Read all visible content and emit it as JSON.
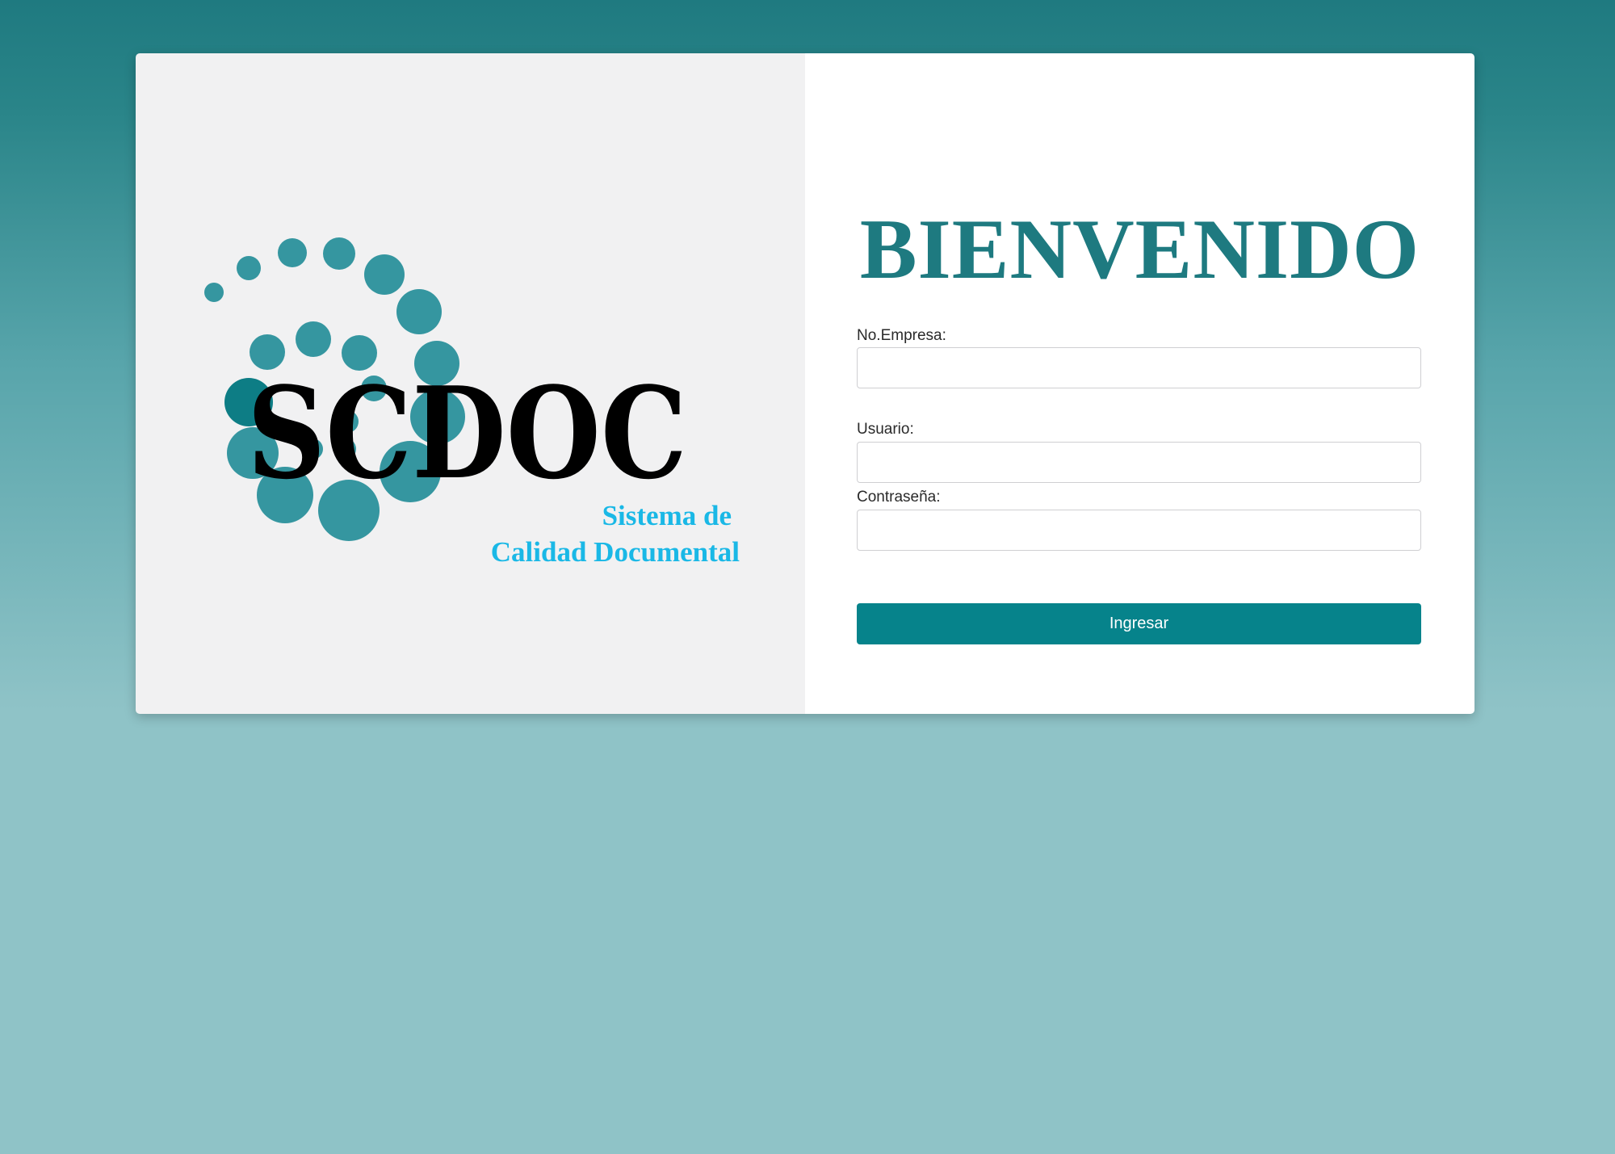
{
  "colors": {
    "brand_teal": "#1e7a80",
    "dot_teal": "#3596a0",
    "dot_dark": "#0d7d85",
    "tagline_cyan": "#1ab8e6",
    "button_bg": "#06838b"
  },
  "logo": {
    "word": "SCDOC",
    "tagline_line1": "Sistema de",
    "tagline_line2": "Calidad Documental"
  },
  "login": {
    "title": "BIENVENIDO",
    "company_label": "No.Empresa:",
    "company_value": "",
    "user_label": "Usuario:",
    "user_value": "",
    "password_label": "Contraseña:",
    "password_value": "",
    "submit_label": "Ingresar"
  }
}
